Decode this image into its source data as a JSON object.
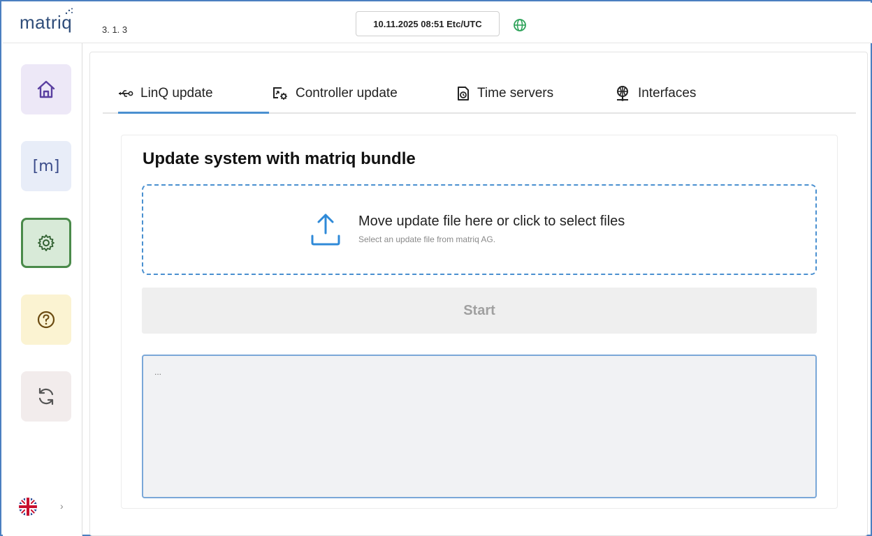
{
  "header": {
    "logo": "matriq",
    "version": "3. 1. 3",
    "datetime": "10.11.2025 08:51 Etc/UTC",
    "globe_icon": "globe-icon"
  },
  "sidebar": {
    "items": [
      {
        "name": "home",
        "icon": "home-icon",
        "color": "#ede8f7"
      },
      {
        "name": "matriq",
        "icon": "m-bracket-icon",
        "label": "[m]",
        "color": "#e8edf8"
      },
      {
        "name": "settings",
        "icon": "gear-icon",
        "color": "#d8ead8",
        "active": true
      },
      {
        "name": "help",
        "icon": "question-icon",
        "color": "#fbf3d2"
      },
      {
        "name": "sync",
        "icon": "sync-icon",
        "color": "#f2ecec"
      }
    ],
    "language_icon": "uk-flag-icon",
    "language_chevron": "›"
  },
  "tabs": [
    {
      "label": "LinQ update",
      "icon": "usb-icon",
      "active": true
    },
    {
      "label": "Controller update",
      "icon": "controller-update-icon"
    },
    {
      "label": "Time servers",
      "icon": "timer-icon"
    },
    {
      "label": "Interfaces",
      "icon": "network-icon"
    }
  ],
  "update_card": {
    "title": "Update system with matriq bundle",
    "dropzone_main": "Move update file here or click to select files",
    "dropzone_sub": "Select an update file from matriq AG.",
    "start_label": "Start",
    "log_placeholder": "..."
  },
  "colors": {
    "accent": "#4a90d0",
    "active_nav_border": "#4a8a4a",
    "logo": "#2f4d7a"
  }
}
